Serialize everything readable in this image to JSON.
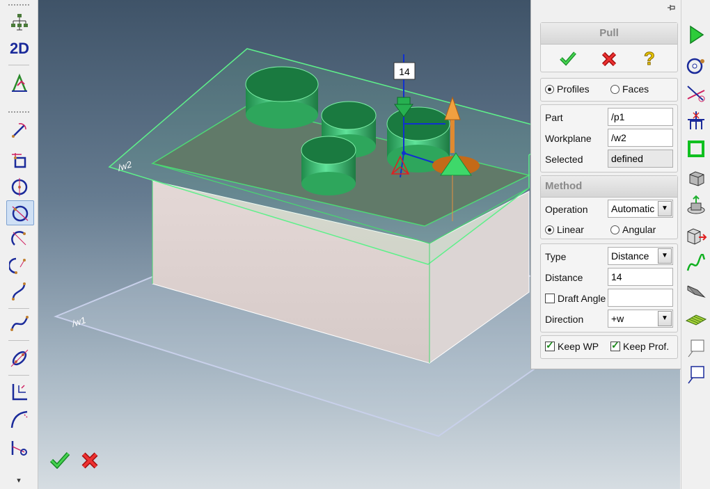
{
  "left_toolbar": {
    "tools": [
      "tree-tool",
      "2d-tool",
      "sketch-tool",
      "line-arc-tool",
      "rectangle-tool",
      "circle-center-tool",
      "circle-tangent-tool",
      "arc-tool",
      "arc-three-point-tool",
      "curve-tool",
      "spline-tool",
      "offset-tool",
      "dimension-tool",
      "fillet-tool",
      "trim-tool"
    ],
    "label_2d": "2D",
    "bottom_arrow": "▾"
  },
  "viewport": {
    "dimension_value": "14",
    "workplane_top_label": "/w2",
    "workplane_bottom_label": "/w1",
    "ok_icon": "green-check-icon",
    "cancel_icon": "red-x-icon"
  },
  "panel": {
    "pin_icon": "pin-icon",
    "title": "Pull",
    "mode": {
      "profiles_label": "Profiles",
      "faces_label": "Faces",
      "selected": "Profiles"
    },
    "part_label": "Part",
    "part_value": "/p1",
    "workplane_label": "Workplane",
    "workplane_value": "/w2",
    "selected_label": "Selected",
    "selected_value": "defined",
    "method_title": "Method",
    "operation_label": "Operation",
    "operation_value": "Automatic",
    "linear_label": "Linear",
    "angular_label": "Angular",
    "motion_selected": "Linear",
    "type_label": "Type",
    "type_value": "Distance",
    "distance_label": "Distance",
    "distance_value": "14",
    "draft_angle_label": "Draft Angle",
    "draft_angle_value": "",
    "direction_label": "Direction",
    "direction_value": "+w",
    "keep_wp_label": "Keep WP",
    "keep_prof_label": "Keep Prof."
  },
  "right_toolbar": {
    "tools": [
      "run-icon",
      "point-on-circle-icon",
      "angle-line-icon",
      "perpendicular-icon",
      "square-icon",
      "block-icon",
      "extrude-icon",
      "cube-arrow-icon",
      "wave-icon",
      "sweep-icon",
      "mesh-icon",
      "note-icon",
      "note-blue-icon"
    ]
  },
  "colors": {
    "accent_green": "#22aa44",
    "cancel_red": "#dd2222",
    "help_yellow": "#e8c800",
    "selection_blue": "#1a2a9a"
  }
}
